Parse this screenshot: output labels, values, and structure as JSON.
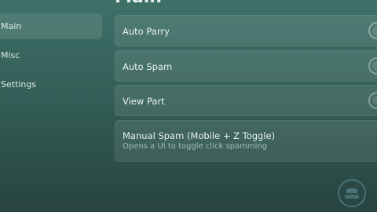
{
  "page": {
    "title": "Main"
  },
  "sidebar": {
    "items": [
      {
        "label": "Main",
        "active": true
      },
      {
        "label": "Misc",
        "active": false
      },
      {
        "label": "Settings",
        "active": false
      }
    ]
  },
  "features": [
    {
      "label": "Auto Parry",
      "type": "toggle",
      "enabled": false
    },
    {
      "label": "Auto Spam",
      "type": "toggle",
      "enabled": false
    },
    {
      "label": "View Part",
      "type": "toggle",
      "enabled": false
    },
    {
      "label": "Manual Spam (Mobile + Z Toggle)",
      "description": "Opens a UI to toggle click spamming",
      "type": "button"
    }
  ],
  "colors": {
    "background_top": "#3f7169",
    "background_bottom": "#27433f",
    "text": "#e6f2ee",
    "muted_text": "#9fbdb6"
  }
}
